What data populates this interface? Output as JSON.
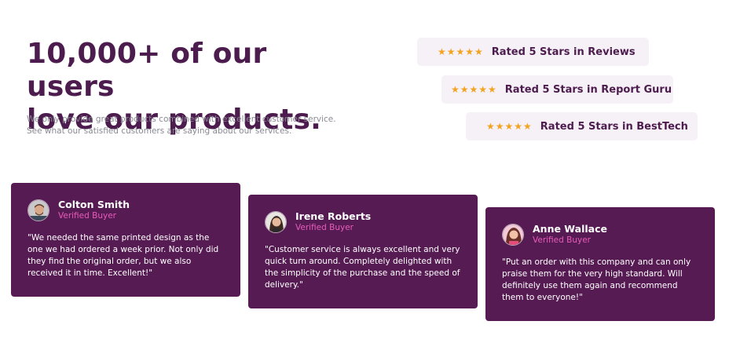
{
  "hero": {
    "headline_line1": "10,000+ of our users",
    "headline_line2": "love our products.",
    "description": "We only provide great products combined with excellent customer service. See what our satisfied customers are saying about our services."
  },
  "ratings": [
    {
      "stars": "★★★★★",
      "label": "Rated 5 Stars in Reviews"
    },
    {
      "stars": "★★★★★",
      "label": "Rated 5 Stars in Report Guru"
    },
    {
      "stars": "★★★★★",
      "label": "Rated 5 Stars in BestTech"
    }
  ],
  "testimonials": [
    {
      "name": "Colton Smith",
      "status": "Verified Buyer",
      "quote": "\"We needed the same printed design as the one we had ordered a week prior. Not only did they find the original order, but we also received it in time. Excellent!\""
    },
    {
      "name": "Irene Roberts",
      "status": "Verified Buyer",
      "quote": "\"Customer service is always excellent and very quick turn around. Completely delighted with the simplicity of the purchase and the speed of delivery.\""
    },
    {
      "name": "Anne Wallace",
      "status": "Verified Buyer",
      "quote": "\"Put an order with this company and can only praise them for the very high standard. Will definitely use them again and recommend them to everyone!\""
    }
  ],
  "colors": {
    "brand_dark": "#4d1c4e",
    "card_bg": "#561b53",
    "star": "#f2a31f",
    "accent_pink": "#e85cbb",
    "rating_bg": "#f6f0f7"
  }
}
